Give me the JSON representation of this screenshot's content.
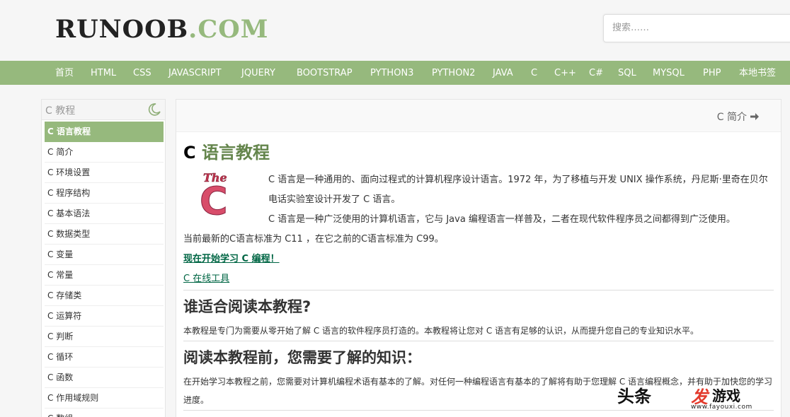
{
  "header": {
    "logo_main": "RUNOOB",
    "logo_suffix": ".COM",
    "search_placeholder": "搜索……"
  },
  "nav": {
    "items": [
      {
        "label": "首页"
      },
      {
        "label": "HTML"
      },
      {
        "label": "CSS"
      },
      {
        "label": "JAVASCRIPT"
      },
      {
        "label": "JQUERY"
      },
      {
        "label": "BOOTSTRAP"
      },
      {
        "label": "PYTHON3"
      },
      {
        "label": "PYTHON2"
      },
      {
        "label": "JAVA"
      },
      {
        "label": "C"
      },
      {
        "label": "C++"
      },
      {
        "label": "C#"
      },
      {
        "label": "SQL"
      },
      {
        "label": "MYSQL"
      },
      {
        "label": "PHP"
      },
      {
        "label": "本地书签"
      }
    ]
  },
  "sidebar": {
    "title": "C 教程",
    "items": [
      {
        "label": "C 语言教程",
        "active": true
      },
      {
        "label": "C 简介"
      },
      {
        "label": "C 环境设置"
      },
      {
        "label": "C 程序结构"
      },
      {
        "label": "C 基本语法"
      },
      {
        "label": "C 数据类型"
      },
      {
        "label": "C 变量"
      },
      {
        "label": "C 常量"
      },
      {
        "label": "C 存储类"
      },
      {
        "label": "C 运算符"
      },
      {
        "label": "C 判断"
      },
      {
        "label": "C 循环"
      },
      {
        "label": "C 函数"
      },
      {
        "label": "C 作用域规则"
      },
      {
        "label": "C 数组"
      }
    ]
  },
  "main": {
    "next_label": "C 简介",
    "title_c": "C",
    "title_rest": "语言教程",
    "logo_text": "The C",
    "intro_1": "C 语言是一种通用的、面向过程式的计算机程序设计语言。1972 年，为了移植与开发 UNIX 操作系统，丹尼斯·里奇在贝尔电话实验室设计开发了 C 语言。",
    "intro_2": "C 语言是一种广泛使用的计算机语言，它与 Java 编程语言一样普及，二者在现代软件程序员之间都得到广泛使用。",
    "standard": "当前最新的C语言标准为 C11 ，在它之前的C语言标准为 C99。",
    "start_link": "现在开始学习 C 编程！",
    "tool_link": "C 在线工具",
    "h2_audience": "谁适合阅读本教程?",
    "audience_text": "本教程是专门为需要从零开始了解 C 语言的软件程序员打造的。本教程将让您对 C 语言有足够的认识，从而提升您自己的专业知识水平。",
    "h2_prereq": "阅读本教程前，您需要了解的知识：",
    "prereq_text": "在开始学习本教程之前，您需要对计算机编程术语有基本的了解。对任何一种编程语言有基本的了解将有助于您理解 C 语言编程概念，并有助于加快您的学习进度。"
  },
  "watermark": {
    "toutiao": "头条",
    "fa": "发",
    "game": "游戏",
    "url": "www.fayouxi.com"
  },
  "colors": {
    "accent": "#96b97d",
    "title_green": "#64854c",
    "link_green": "#006644"
  }
}
